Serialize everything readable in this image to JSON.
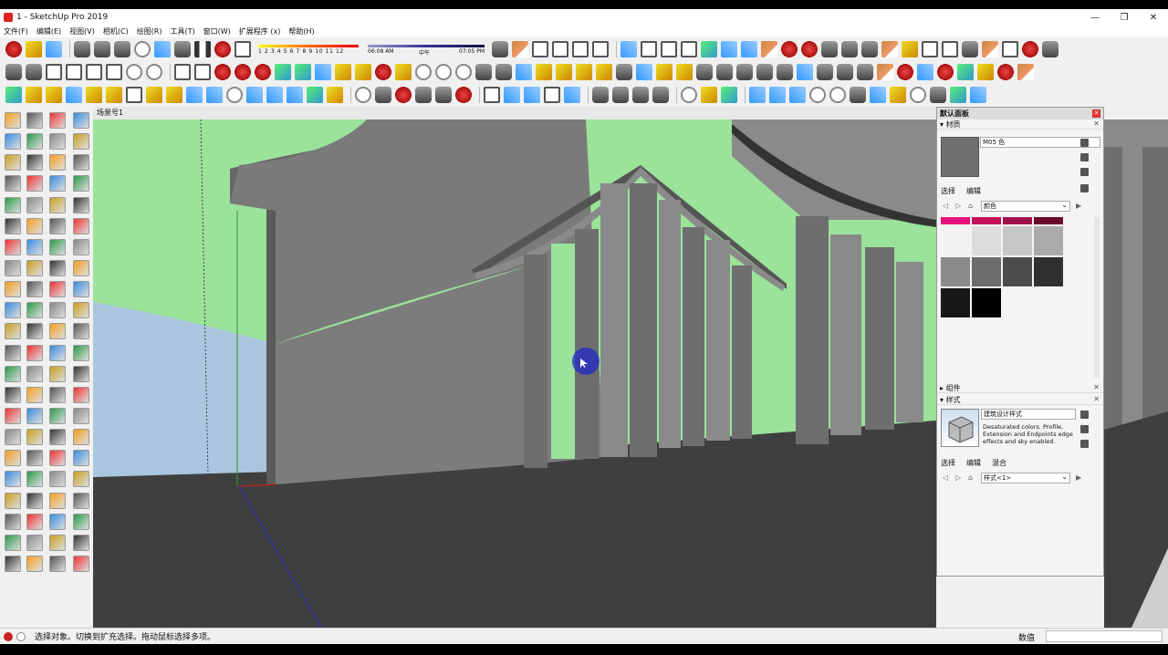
{
  "window": {
    "title": "1 - SketchUp Pro 2019",
    "controls": [
      "—",
      "❐",
      "✕"
    ]
  },
  "menu": [
    "文件(F)",
    "编辑(E)",
    "视图(V)",
    "相机(C)",
    "绘图(R)",
    "工具(T)",
    "窗口(W)",
    "扩展程序 (x)",
    "帮助(H)"
  ],
  "shadow": {
    "months": "1 2 3 4 5 6 7 8 9 10 11 12",
    "time_start": "06:08 AM",
    "time_mid": "中午",
    "time_end": "07:05 PM"
  },
  "scene_tab": "场景号1",
  "panel": {
    "title": "默认面板",
    "materials": {
      "header": "材质",
      "name": "M05 色",
      "tab_select": "选择",
      "tab_edit": "编辑",
      "library": "颜色",
      "swatch_color": "#707070",
      "swatches": [
        "#e8107a",
        "#c4105a",
        "#a0104a",
        "#6a0a2a",
        "#f2f2f2",
        "#dcdcdc",
        "#c6c6c6",
        "#aaaaaa",
        "#8a8a8a",
        "#6c6c6c",
        "#4c4c4c",
        "#303030",
        "#181818",
        "#000000"
      ]
    },
    "components": {
      "header": "组件"
    },
    "styles": {
      "header": "样式",
      "name": "建筑设计样式",
      "description": "Desaturated colors. Profile, Extension and Endpoints edge effects and sky enabled.",
      "tab_select": "选择",
      "tab_edit": "编辑",
      "tab_mix": "混合",
      "current": "样式<1>"
    }
  },
  "status": {
    "text": "选择对象。切换到扩充选择。拖动鼠标选择多项。",
    "measure_label": "数值",
    "measure_value": ""
  },
  "colors": {
    "sky": "#9be29b",
    "ground": "#3f3f3f",
    "wall": "#7a7a7a",
    "water": "#a9c6de",
    "accent_blue": "#2328c8"
  }
}
